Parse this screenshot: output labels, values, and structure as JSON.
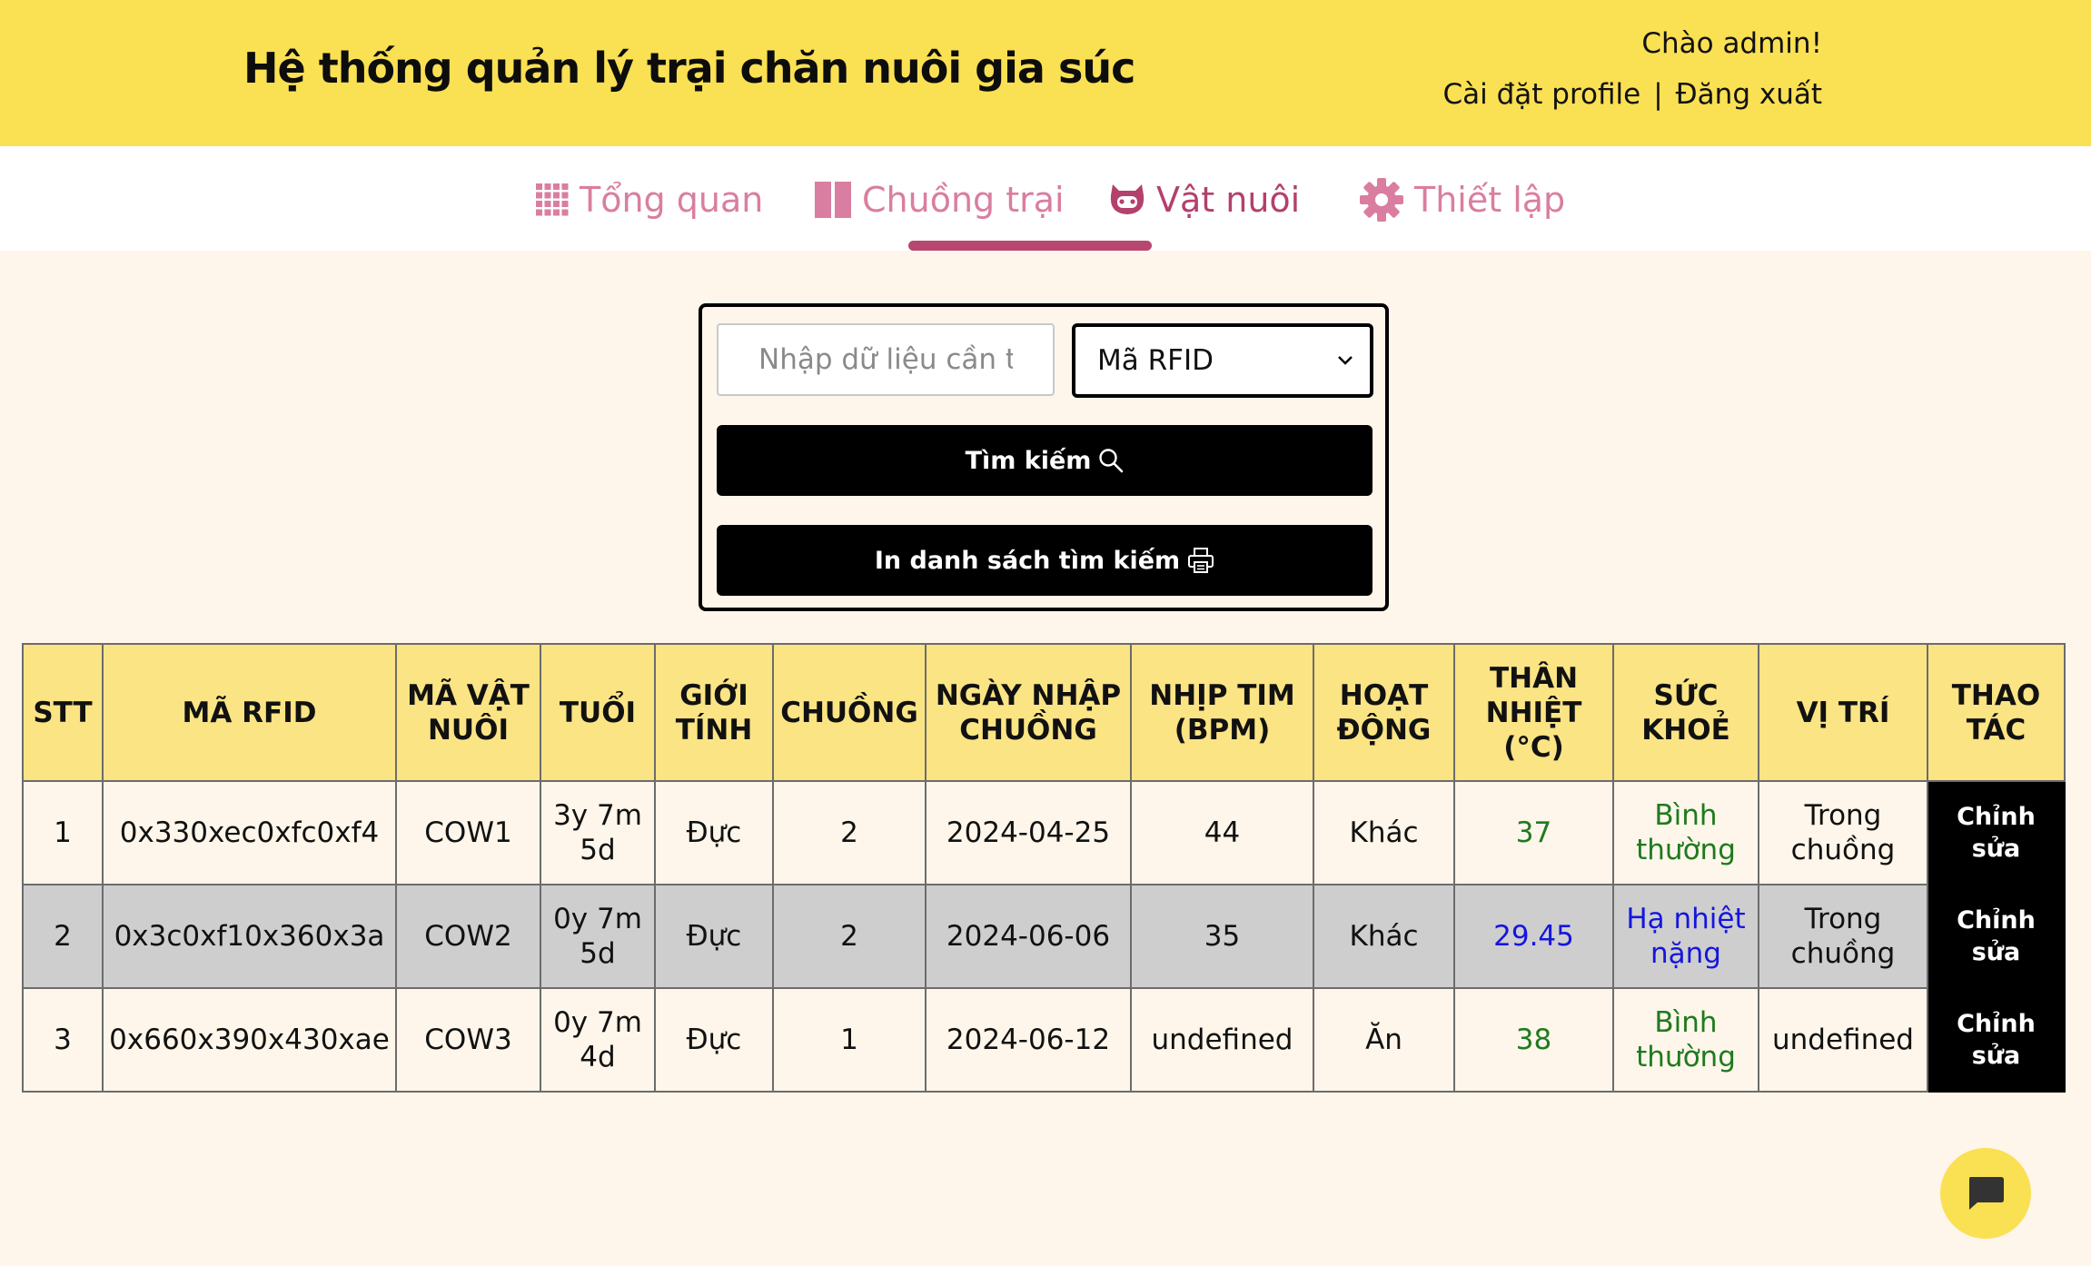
{
  "header": {
    "title": "Hệ thống quản lý trại chăn nuôi gia súc",
    "greeting": "Chào admin!",
    "profile_link": "Cài đặt profile",
    "separator": "|",
    "logout_link": "Đăng xuất"
  },
  "nav": {
    "tabs": [
      {
        "label": "Tổng quan",
        "icon": "grid-icon"
      },
      {
        "label": "Chuồng trại",
        "icon": "columns-icon"
      },
      {
        "label": "Vật nuôi",
        "icon": "animal-icon",
        "active": true
      },
      {
        "label": "Thiết lập",
        "icon": "gear-icon"
      }
    ]
  },
  "search": {
    "placeholder": "Nhập dữ liệu cần tìm",
    "field_selected": "Mã RFID",
    "search_button": "Tìm kiếm",
    "print_button": "In danh sách tìm kiếm"
  },
  "table": {
    "headers": [
      "STT",
      "MÃ RFID",
      "MÃ VẬT NUÔI",
      "TUỔI",
      "GIỚI TÍNH",
      "CHUỒNG",
      "NGÀY NHẬP CHUỒNG",
      "NHỊP TIM (BPM)",
      "HOẠT ĐỘNG",
      "THÂN NHIỆT (°C)",
      "SỨC KHOẺ",
      "VỊ TRÍ",
      "THAO TÁC"
    ],
    "rows": [
      {
        "stt": "1",
        "rfid": "0x330xec0xfc0xf4",
        "code": "COW1",
        "age": "3y 7m 5d",
        "gender": "Đực",
        "barn": "2",
        "date": "2024-04-25",
        "heart": "44",
        "activity": "Khác",
        "temp": "37",
        "health": "Bình thường",
        "location": "Trong chuồng",
        "action": "Chỉnh sửa"
      },
      {
        "stt": "2",
        "rfid": "0x3c0xf10x360x3a",
        "code": "COW2",
        "age": "0y 7m 5d",
        "gender": "Đực",
        "barn": "2",
        "date": "2024-06-06",
        "heart": "35",
        "activity": "Khác",
        "temp": "29.45",
        "health": "Hạ nhiệt nặng",
        "location": "Trong chuồng",
        "action": "Chỉnh sửa"
      },
      {
        "stt": "3",
        "rfid": "0x660x390x430xae",
        "code": "COW3",
        "age": "0y 7m 4d",
        "gender": "Đực",
        "barn": "1",
        "date": "2024-06-12",
        "heart": "undefined",
        "activity": "Ăn",
        "temp": "38",
        "health": "Bình thường",
        "location": "undefined",
        "action": "Chỉnh sửa"
      }
    ]
  },
  "colors": {
    "header_bg": "#fae053",
    "page_bg": "#fef6ea",
    "tab_color": "#d97ea0",
    "tab_active": "#b3406d",
    "table_header_bg": "#fae484",
    "status_normal": "#1f7a1f",
    "status_low": "#1515e0"
  },
  "chat": {
    "icon": "chat-icon"
  }
}
